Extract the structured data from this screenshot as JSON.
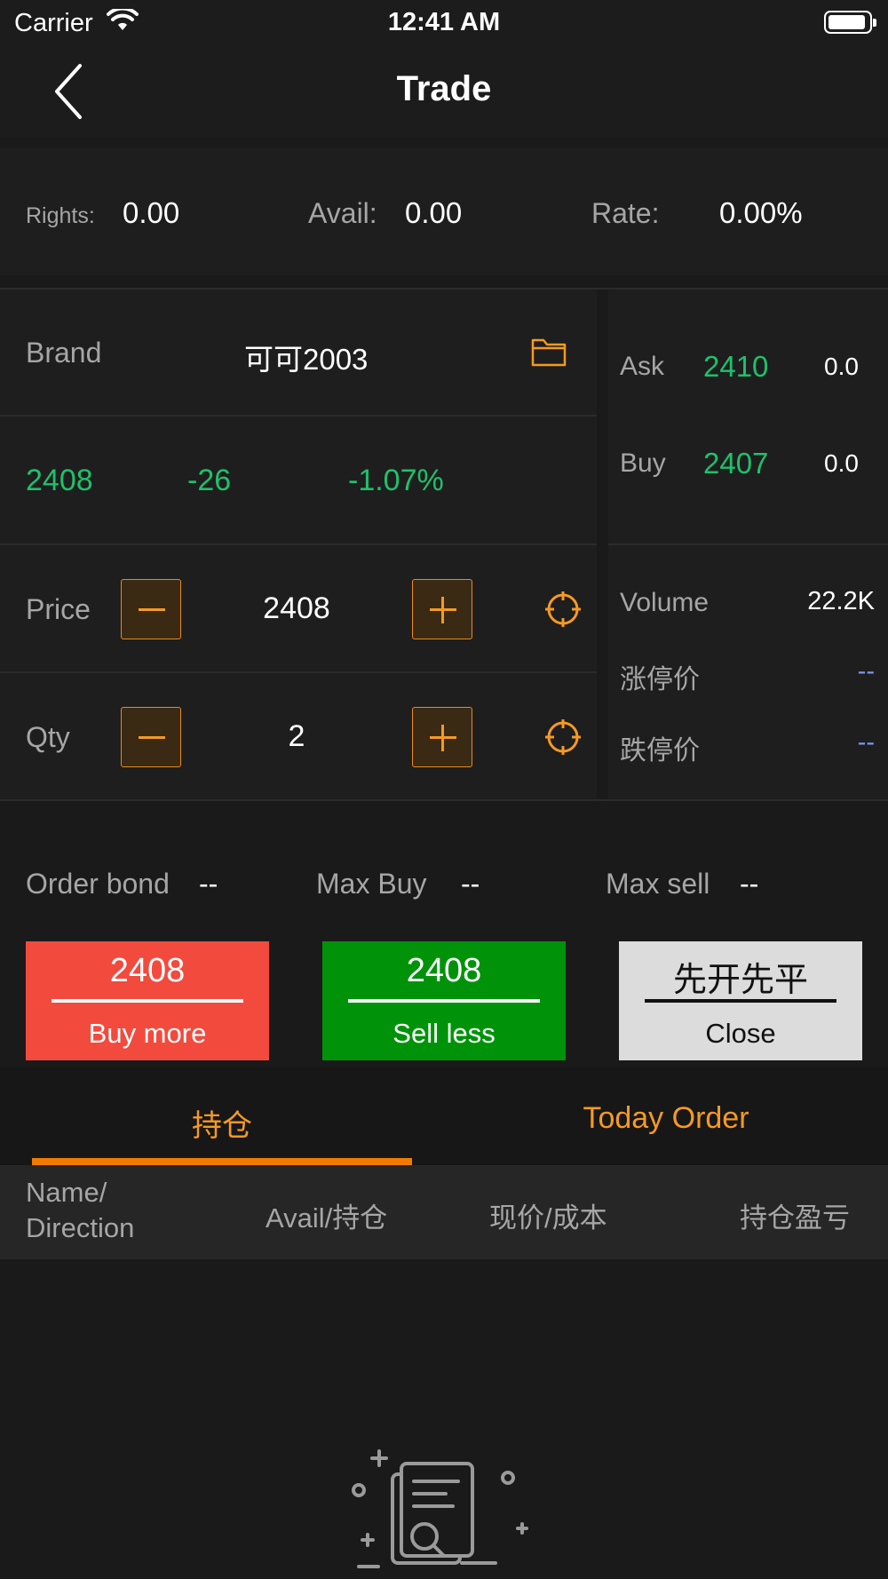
{
  "status_bar": {
    "carrier": "Carrier",
    "time": "12:41 AM"
  },
  "nav": {
    "title": "Trade"
  },
  "account": {
    "rights_label": "Rights:",
    "rights_value": "0.00",
    "avail_label": "Avail:",
    "avail_value": "0.00",
    "rate_label": "Rate:",
    "rate_value": "0.00%"
  },
  "brand": {
    "label": "Brand",
    "value": "可可2003"
  },
  "quote": {
    "last": "2408",
    "change": "-26",
    "change_pct": "-1.07%"
  },
  "price": {
    "label": "Price",
    "value": "2408"
  },
  "qty": {
    "label": "Qty",
    "value": "2"
  },
  "book": {
    "ask_label": "Ask",
    "ask_price": "2410",
    "ask_qty": "0.0",
    "buy_label": "Buy",
    "buy_price": "2407",
    "buy_qty": "0.0"
  },
  "stats": {
    "volume_label": "Volume",
    "volume_value": "22.2K",
    "limit_up_label": "涨停价",
    "limit_up_value": "--",
    "limit_down_label": "跌停价",
    "limit_down_value": "--"
  },
  "order_info": {
    "bond_label": "Order bond",
    "bond_value": "--",
    "max_buy_label": "Max Buy",
    "max_buy_value": "--",
    "max_sell_label": "Max sell",
    "max_sell_value": "--"
  },
  "actions": {
    "buy": {
      "price": "2408",
      "label": "Buy more"
    },
    "sell": {
      "price": "2408",
      "label": "Sell less"
    },
    "close": {
      "price": "先开先平",
      "label": "Close"
    }
  },
  "tabs": {
    "positions": "持仓",
    "today_order": "Today Order"
  },
  "table_headers": {
    "name_line1": "Name/",
    "name_line2": "Direction",
    "avail": "Avail/持仓",
    "price_cost": "现价/成本",
    "pnl": "持仓盈亏"
  },
  "colors": {
    "accent": "#f59a23",
    "up_green": "#1ec16a",
    "buy_red": "#f24a3d",
    "sell_green": "#00930a",
    "close_gray": "#dcdcdc",
    "background": "#1a1a1a"
  }
}
